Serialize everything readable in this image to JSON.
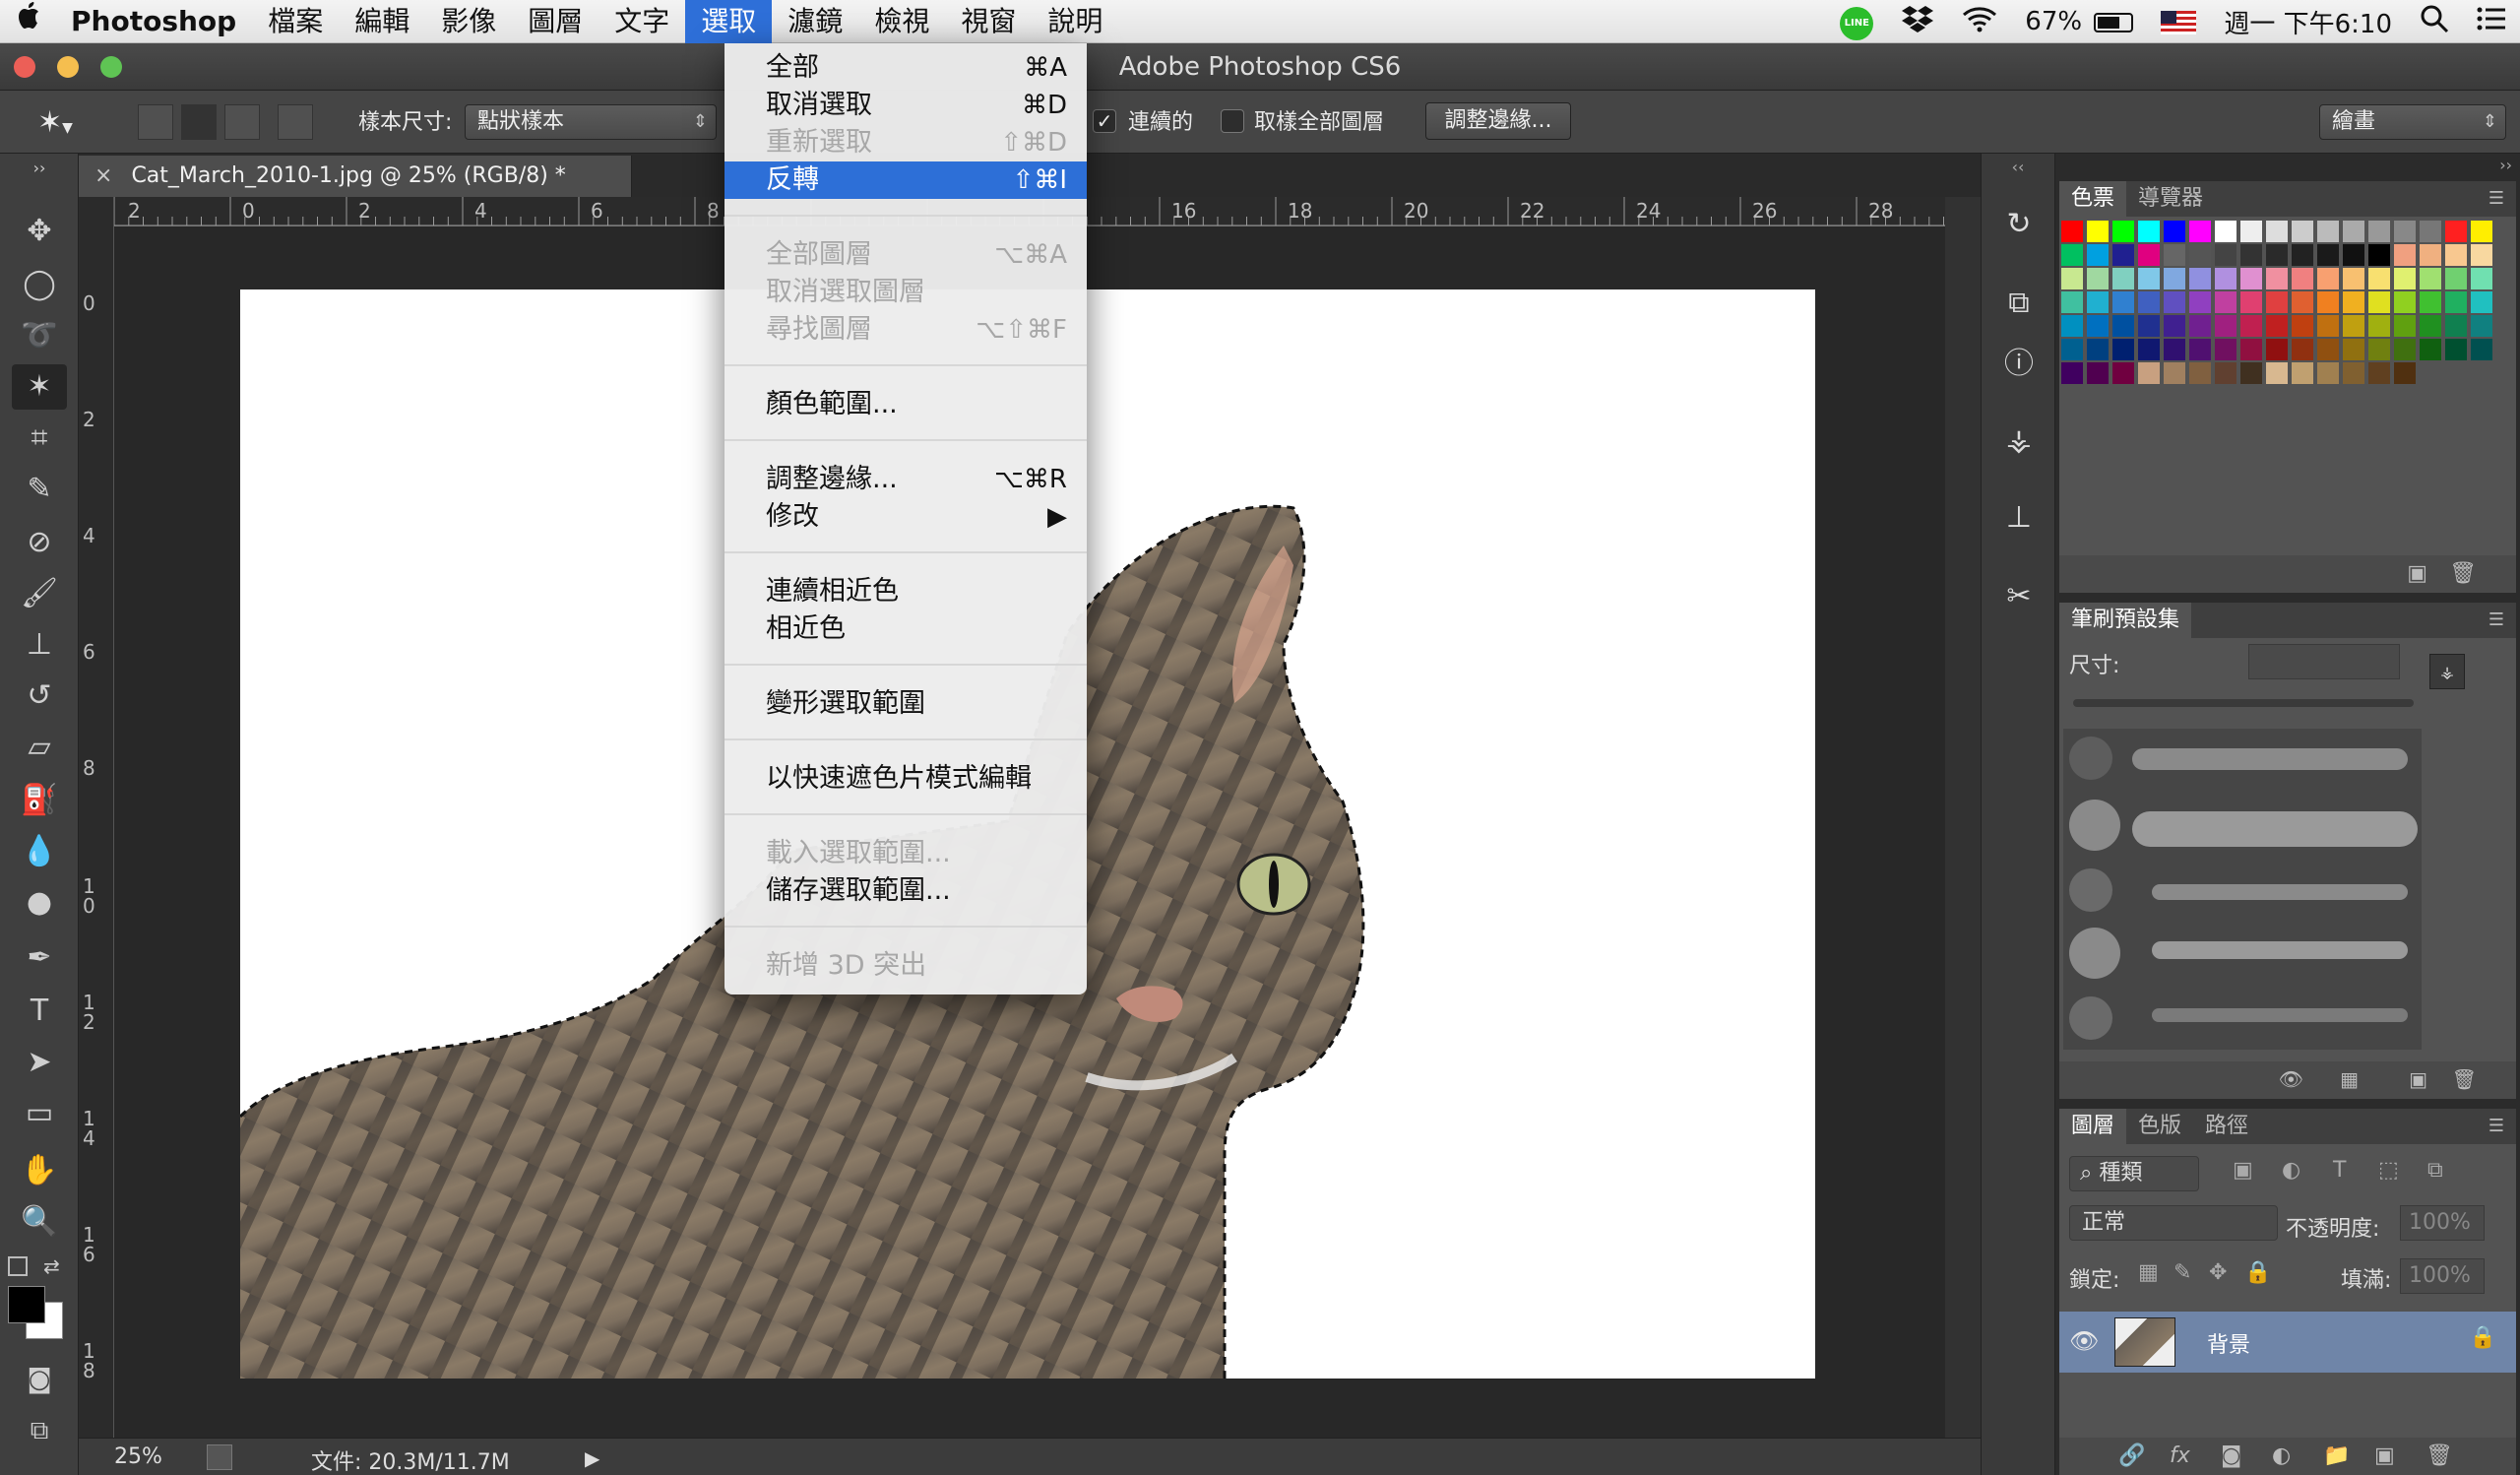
{
  "menubar": {
    "apple": "",
    "app": "Photoshop",
    "items": [
      "檔案",
      "編輯",
      "影像",
      "圖層",
      "文字",
      "選取",
      "濾鏡",
      "檢視",
      "視窗",
      "說明"
    ],
    "active_index": 5,
    "battery": "67%",
    "clock": "週一 下午6:10",
    "line_badge": "LINE"
  },
  "window": {
    "title": "Adobe Photoshop CS6"
  },
  "options_bar": {
    "sample_size_label": "樣本尺寸:",
    "sample_size_value": "點狀樣本",
    "contiguous_label": "連續的",
    "contiguous_checked": true,
    "sample_all_label": "取樣全部圖層",
    "sample_all_checked": false,
    "refine_edge_button": "調整邊緣...",
    "workspace_select": "繪畫"
  },
  "document": {
    "tab_title": "Cat_March_2010-1.jpg @ 25% (RGB/8) *",
    "tab_close": "×"
  },
  "ruler": {
    "h_ticks": [
      "2",
      "0",
      "2",
      "4",
      "6",
      "8",
      "16",
      "18",
      "20",
      "22",
      "24",
      "26",
      "28"
    ],
    "v_ticks": [
      "0",
      "2",
      "4",
      "6",
      "8",
      "1\n0",
      "1\n2",
      "1\n4",
      "1\n6",
      "1\n8"
    ]
  },
  "status": {
    "zoom": "25%",
    "doc_size": "文件: 20.3M/11.7M",
    "arrow": "▶"
  },
  "select_menu": {
    "items": [
      {
        "label": "全部",
        "shortcut": "⌘A",
        "disabled": false,
        "highlighted": false
      },
      {
        "label": "取消選取",
        "shortcut": "⌘D",
        "disabled": false,
        "highlighted": false
      },
      {
        "label": "重新選取",
        "shortcut": "⇧⌘D",
        "disabled": true,
        "highlighted": false
      },
      {
        "label": "反轉",
        "shortcut": "⇧⌘I",
        "disabled": false,
        "highlighted": true
      },
      {
        "label": "全部圖層",
        "shortcut": "⌥⌘A",
        "disabled": true,
        "highlighted": false
      },
      {
        "label": "取消選取圖層",
        "shortcut": "",
        "disabled": true,
        "highlighted": false
      },
      {
        "label": "尋找圖層",
        "shortcut": "⌥⇧⌘F",
        "disabled": true,
        "highlighted": false
      },
      {
        "label": "顏色範圍...",
        "shortcut": "",
        "disabled": false,
        "highlighted": false
      },
      {
        "label": "調整邊緣...",
        "shortcut": "⌥⌘R",
        "disabled": false,
        "highlighted": false
      },
      {
        "label": "修改",
        "shortcut": "▶",
        "disabled": false,
        "highlighted": false
      },
      {
        "label": "連續相近色",
        "shortcut": "",
        "disabled": false,
        "highlighted": false
      },
      {
        "label": "相近色",
        "shortcut": "",
        "disabled": false,
        "highlighted": false
      },
      {
        "label": "變形選取範圍",
        "shortcut": "",
        "disabled": false,
        "highlighted": false
      },
      {
        "label": "以快速遮色片模式編輯",
        "shortcut": "",
        "disabled": false,
        "highlighted": false
      },
      {
        "label": "載入選取範圍...",
        "shortcut": "",
        "disabled": true,
        "highlighted": false
      },
      {
        "label": "儲存選取範圍...",
        "shortcut": "",
        "disabled": false,
        "highlighted": false
      },
      {
        "label": "新增 3D 突出",
        "shortcut": "",
        "disabled": true,
        "highlighted": false
      }
    ]
  },
  "swatches_panel": {
    "tabs": [
      "色票",
      "導覽器"
    ]
  },
  "brush_panel": {
    "title": "筆刷預設集",
    "size_label": "尺寸:"
  },
  "layers_panel": {
    "tabs": [
      "圖層",
      "色版",
      "路徑"
    ],
    "filter_kind": "種類",
    "blend_mode": "正常",
    "opacity_label": "不透明度:",
    "opacity_value": "100%",
    "lock_label": "鎖定:",
    "fill_label": "填滿:",
    "fill_value": "100%",
    "layer_name": "背景"
  },
  "colors": {
    "menu_highlight": "#2d6fd7",
    "layer_selected": "#6f85a8",
    "close": "#ec5f57",
    "minimize": "#f5be4f",
    "zoom": "#5fc454"
  }
}
